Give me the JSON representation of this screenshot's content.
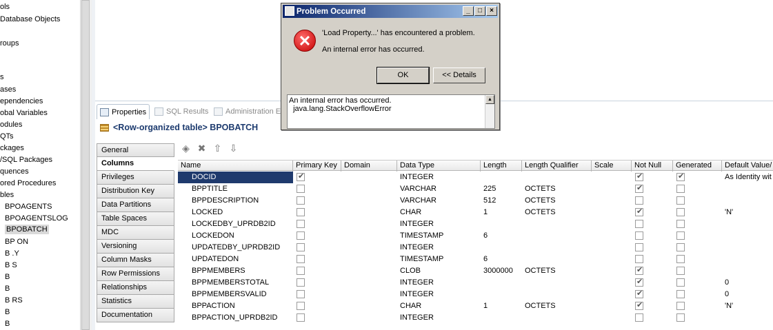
{
  "tree": {
    "items": [
      {
        "label": "ols"
      },
      {
        "label": " Database Objects"
      },
      {
        "label": ""
      },
      {
        "label": "roups"
      },
      {
        "label": ""
      },
      {
        "label": "s"
      },
      {
        "label": "ases"
      },
      {
        "label": "ependencies"
      },
      {
        "label": "obal Variables"
      },
      {
        "label": "odules"
      },
      {
        "label": "QTs"
      },
      {
        "label": "ckages"
      },
      {
        "label": "/SQL Packages"
      },
      {
        "label": "quences"
      },
      {
        "label": "ored Procedures"
      },
      {
        "label": "bles"
      },
      {
        "label": "BPOAGENTS"
      },
      {
        "label": "BPOAGENTSLOG"
      },
      {
        "label": "BPOBATCH"
      },
      {
        "label": "BP                    ON"
      },
      {
        "label": "B                       .Y"
      },
      {
        "label": "B                          S"
      },
      {
        "label": "B"
      },
      {
        "label": "B"
      },
      {
        "label": "B                       RS"
      },
      {
        "label": "B"
      },
      {
        "label": "B"
      }
    ]
  },
  "view_tabs": [
    {
      "label": "Properties",
      "icon": "properties-icon"
    },
    {
      "label": "SQL Results",
      "icon": "sql-results-icon"
    },
    {
      "label": "Administration Ex",
      "icon": "administration-icon"
    }
  ],
  "object_title": "<Row-organized table> BPOBATCH",
  "side_tabs": [
    {
      "label": "General"
    },
    {
      "label": "Columns"
    },
    {
      "label": "Privileges"
    },
    {
      "label": "Distribution Key"
    },
    {
      "label": "Data Partitions"
    },
    {
      "label": "Table Spaces"
    },
    {
      "label": "MDC"
    },
    {
      "label": "Versioning"
    },
    {
      "label": "Column Masks"
    },
    {
      "label": "Row Permissions"
    },
    {
      "label": "Relationships"
    },
    {
      "label": "Statistics"
    },
    {
      "label": "Documentation"
    }
  ],
  "toolbar": {
    "add": "add-icon",
    "delete": "delete-icon",
    "move_up": "move-up-icon",
    "move_down": "move-down-icon"
  },
  "grid": {
    "headers": [
      "Name",
      "Primary Key",
      "Domain",
      "Data Type",
      "Length",
      "Length Qualifier",
      "Scale",
      "Not Null",
      "Generated",
      "Default Value/"
    ],
    "rows": [
      {
        "name": "DOCID",
        "pk": true,
        "domain": "",
        "type": "INTEGER",
        "length": "",
        "qualifier": "",
        "scale": "",
        "notnull": true,
        "generated": true,
        "default": "As Identity wit"
      },
      {
        "name": "BPPTITLE",
        "pk": false,
        "domain": "",
        "type": "VARCHAR",
        "length": "225",
        "qualifier": "OCTETS",
        "scale": "",
        "notnull": true,
        "generated": false,
        "default": ""
      },
      {
        "name": "BPPDESCRIPTION",
        "pk": false,
        "domain": "",
        "type": "VARCHAR",
        "length": "512",
        "qualifier": "OCTETS",
        "scale": "",
        "notnull": false,
        "generated": false,
        "default": ""
      },
      {
        "name": "LOCKED",
        "pk": false,
        "domain": "",
        "type": "CHAR",
        "length": "1",
        "qualifier": "OCTETS",
        "scale": "",
        "notnull": true,
        "generated": false,
        "default": "'N'"
      },
      {
        "name": "LOCKEDBY_UPRDB2ID",
        "pk": false,
        "domain": "",
        "type": "INTEGER",
        "length": "",
        "qualifier": "",
        "scale": "",
        "notnull": false,
        "generated": false,
        "default": ""
      },
      {
        "name": "LOCKEDON",
        "pk": false,
        "domain": "",
        "type": "TIMESTAMP",
        "length": "6",
        "qualifier": "",
        "scale": "",
        "notnull": false,
        "generated": false,
        "default": ""
      },
      {
        "name": "UPDATEDBY_UPRDB2ID",
        "pk": false,
        "domain": "",
        "type": "INTEGER",
        "length": "",
        "qualifier": "",
        "scale": "",
        "notnull": false,
        "generated": false,
        "default": ""
      },
      {
        "name": "UPDATEDON",
        "pk": false,
        "domain": "",
        "type": "TIMESTAMP",
        "length": "6",
        "qualifier": "",
        "scale": "",
        "notnull": false,
        "generated": false,
        "default": ""
      },
      {
        "name": "BPPMEMBERS",
        "pk": false,
        "domain": "",
        "type": "CLOB",
        "length": "3000000",
        "qualifier": "OCTETS",
        "scale": "",
        "notnull": true,
        "generated": false,
        "default": ""
      },
      {
        "name": "BPPMEMBERSTOTAL",
        "pk": false,
        "domain": "",
        "type": "INTEGER",
        "length": "",
        "qualifier": "",
        "scale": "",
        "notnull": true,
        "generated": false,
        "default": "0"
      },
      {
        "name": "BPPMEMBERSVALID",
        "pk": false,
        "domain": "",
        "type": "INTEGER",
        "length": "",
        "qualifier": "",
        "scale": "",
        "notnull": true,
        "generated": false,
        "default": "0"
      },
      {
        "name": "BPPACTION",
        "pk": false,
        "domain": "",
        "type": "CHAR",
        "length": "1",
        "qualifier": "OCTETS",
        "scale": "",
        "notnull": true,
        "generated": false,
        "default": "'N'"
      },
      {
        "name": "BPPACTION_UPRDB2ID",
        "pk": false,
        "domain": "",
        "type": "INTEGER",
        "length": "",
        "qualifier": "",
        "scale": "",
        "notnull": false,
        "generated": false,
        "default": ""
      }
    ]
  },
  "dialog": {
    "title": "Problem Occurred",
    "message": "'Load Property...' has encountered a problem.",
    "detail_message": "An internal error has occurred.",
    "ok_label": "OK",
    "details_label": "<< Details",
    "details_text": "An internal error has occurred.\n  java.lang.StackOverflowError",
    "minimize": "_",
    "maximize": "□",
    "close": "×"
  }
}
